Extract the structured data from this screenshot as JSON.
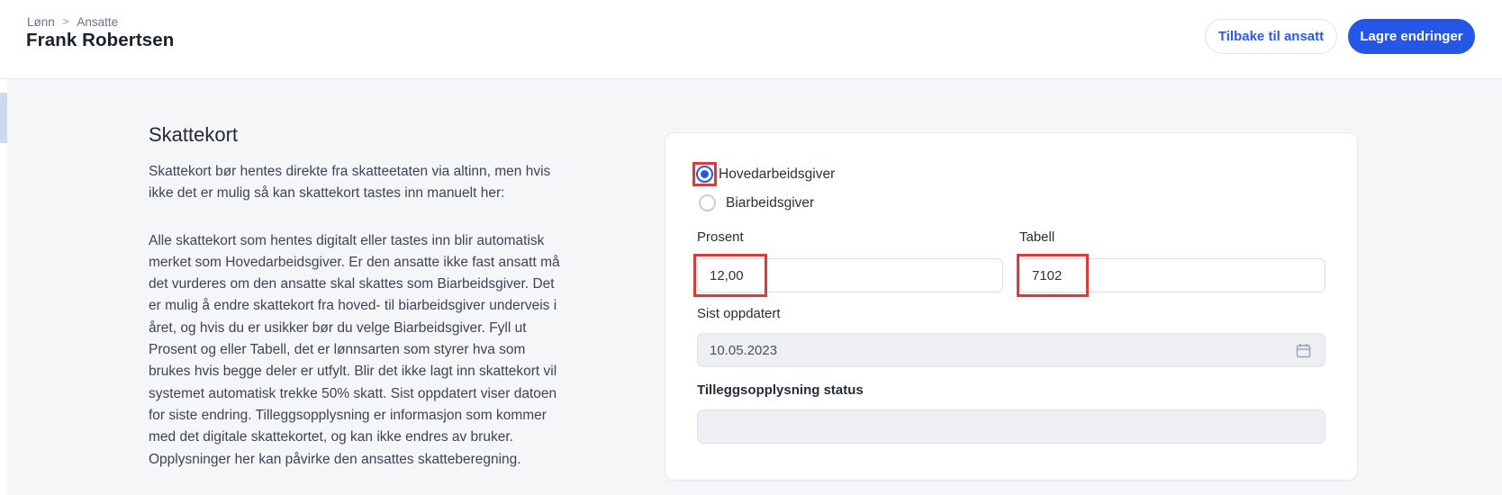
{
  "page": {
    "breadcrumb": {
      "item1": "Lønn",
      "separator": ">",
      "item2": "Ansatte"
    },
    "title": "Frank Robertsen"
  },
  "header_actions": {
    "back_label": "Tilbake til ansatt",
    "save_label": "Lagre endringer"
  },
  "section": {
    "heading": "Skattekort",
    "intro": "Skattekort bør hentes direkte fra skatteetaten via altinn, men hvis ikke det er mulig så kan skattekort tastes inn manuelt her:",
    "description": "Alle skattekort som hentes digitalt eller tastes inn blir automatisk merket som Hovedarbeidsgiver. Er den ansatte ikke fast ansatt må det vurderes om den ansatte skal skattes som Biarbeidsgiver. Det er mulig å endre skattekort fra hoved- til biarbeidsgiver underveis i året, og hvis du er usikker bør du velge Biarbeidsgiver. Fyll ut Prosent og eller Tabell, det er lønnsarten som styrer hva som brukes hvis begge deler er utfylt. Blir det ikke lagt inn skattekort vil systemet automatisk trekke 50% skatt. Sist oppdatert viser datoen for siste endring. Tilleggsopplysning er informasjon som kommer med det digitale skattekortet, og kan ikke endres av bruker. Opplysninger her kan påvirke den ansattes skatteberegning."
  },
  "form": {
    "employer_type": {
      "options": [
        {
          "label": "Hovedarbeidsgiver",
          "selected": true
        },
        {
          "label": "Biarbeidsgiver",
          "selected": false
        }
      ]
    },
    "prosent": {
      "label": "Prosent",
      "value": "12,00"
    },
    "tabell": {
      "label": "Tabell",
      "value": "7102"
    },
    "sist_oppdatert": {
      "label": "Sist oppdatert",
      "value": "10.05.2023",
      "disabled": true,
      "icon": "calendar-icon"
    },
    "tilleggsopplysning": {
      "label": "Tilleggsopplysning status",
      "value": "",
      "disabled": true
    }
  },
  "annotations": {
    "highlight_color": "#dc3a3a",
    "highlighted_elements": [
      "hovedarbeidsgiver-radio",
      "prosent-input",
      "tabell-input"
    ]
  },
  "colors": {
    "accent": "#2457e7",
    "background": "#f4f6f8",
    "sidebar_indicator": "#ccd9f3"
  }
}
